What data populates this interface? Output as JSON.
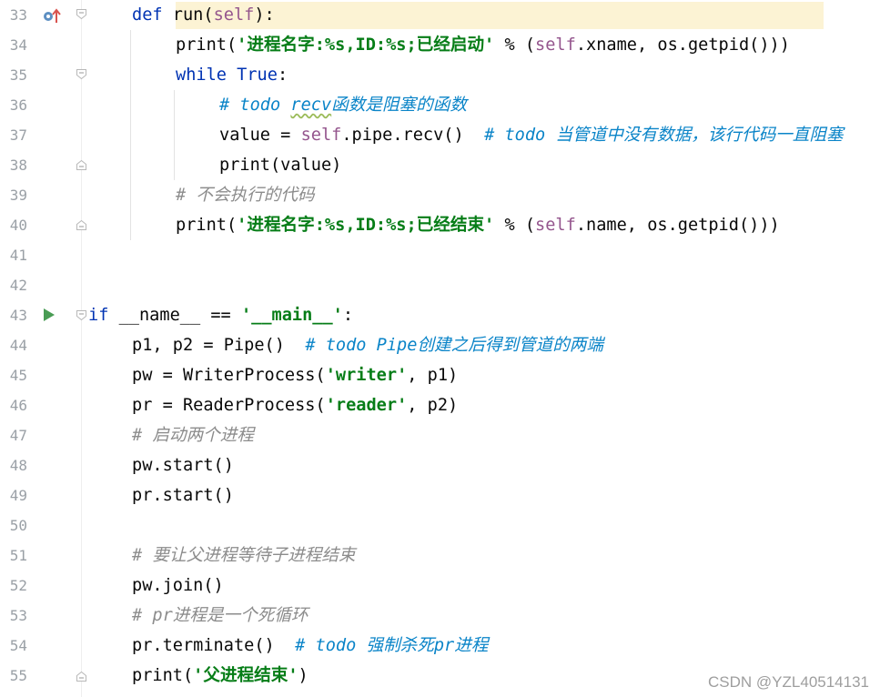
{
  "lines": [
    {
      "num": "33",
      "tokens": [
        {
          "t": "def ",
          "c": "kw"
        },
        {
          "t": "run(",
          "c": ""
        },
        {
          "t": "self",
          "c": "sf"
        },
        {
          "t": "):",
          "c": ""
        }
      ]
    },
    {
      "num": "34",
      "tokens": [
        {
          "t": "print(",
          "c": ""
        },
        {
          "t": "'进程名字:%s,ID:%s;已经启动'",
          "c": "str"
        },
        {
          "t": " % (",
          "c": ""
        },
        {
          "t": "self",
          "c": "sf"
        },
        {
          "t": ".xname, os.getpid()))",
          "c": ""
        }
      ]
    },
    {
      "num": "35",
      "tokens": [
        {
          "t": "while ",
          "c": "kw"
        },
        {
          "t": "True",
          "c": "kw"
        },
        {
          "t": ":",
          "c": ""
        }
      ]
    },
    {
      "num": "36",
      "tokens": [
        {
          "t": "# ",
          "c": "todo"
        },
        {
          "t": "todo ",
          "c": "todo"
        },
        {
          "t": "recv",
          "c": "todo wavy"
        },
        {
          "t": "函数是阻塞的函数",
          "c": "todo"
        }
      ]
    },
    {
      "num": "37",
      "tokens": [
        {
          "t": "value = ",
          "c": ""
        },
        {
          "t": "self",
          "c": "sf"
        },
        {
          "t": ".pipe.recv()  ",
          "c": ""
        },
        {
          "t": "# todo 当管道中没有数据，该行代码一直阻塞",
          "c": "todo"
        }
      ]
    },
    {
      "num": "38",
      "tokens": [
        {
          "t": "print(value)",
          "c": ""
        }
      ]
    },
    {
      "num": "39",
      "tokens": [
        {
          "t": "# 不会执行的代码",
          "c": "cm"
        }
      ]
    },
    {
      "num": "40",
      "tokens": [
        {
          "t": "print(",
          "c": ""
        },
        {
          "t": "'进程名字:%s,ID:%s;已经结束'",
          "c": "str"
        },
        {
          "t": " % (",
          "c": ""
        },
        {
          "t": "self",
          "c": "sf"
        },
        {
          "t": ".name, os.getpid()))",
          "c": ""
        }
      ]
    },
    {
      "num": "41",
      "tokens": []
    },
    {
      "num": "42",
      "tokens": []
    },
    {
      "num": "43",
      "tokens": [
        {
          "t": "if ",
          "c": "kw"
        },
        {
          "t": "__name__ == ",
          "c": ""
        },
        {
          "t": "'__main__'",
          "c": "str"
        },
        {
          "t": ":",
          "c": ""
        }
      ]
    },
    {
      "num": "44",
      "tokens": [
        {
          "t": "p1, p2 = Pipe()  ",
          "c": ""
        },
        {
          "t": "# todo Pipe创建之后得到管道的两端",
          "c": "todo"
        }
      ]
    },
    {
      "num": "45",
      "tokens": [
        {
          "t": "pw = WriterProcess(",
          "c": ""
        },
        {
          "t": "'writer'",
          "c": "str"
        },
        {
          "t": ", p1)",
          "c": ""
        }
      ]
    },
    {
      "num": "46",
      "tokens": [
        {
          "t": "pr = ReaderProcess(",
          "c": ""
        },
        {
          "t": "'reader'",
          "c": "str"
        },
        {
          "t": ", p2)",
          "c": ""
        }
      ]
    },
    {
      "num": "47",
      "tokens": [
        {
          "t": "# 启动两个进程",
          "c": "cm"
        }
      ]
    },
    {
      "num": "48",
      "tokens": [
        {
          "t": "pw.start()",
          "c": ""
        }
      ]
    },
    {
      "num": "49",
      "tokens": [
        {
          "t": "pr.start()",
          "c": ""
        }
      ]
    },
    {
      "num": "50",
      "tokens": []
    },
    {
      "num": "51",
      "tokens": [
        {
          "t": "# 要让父进程等待子进程结束",
          "c": "cm"
        }
      ]
    },
    {
      "num": "52",
      "tokens": [
        {
          "t": "pw.join()",
          "c": ""
        }
      ]
    },
    {
      "num": "53",
      "tokens": [
        {
          "t": "# pr进程是一个死循环",
          "c": "cm"
        }
      ]
    },
    {
      "num": "54",
      "tokens": [
        {
          "t": "pr.terminate()  ",
          "c": ""
        },
        {
          "t": "# todo 强制杀死pr进程",
          "c": "todo"
        }
      ]
    },
    {
      "num": "55",
      "tokens": [
        {
          "t": "print(",
          "c": ""
        },
        {
          "t": "'父进程结束'",
          "c": "str"
        },
        {
          "t": ")",
          "c": ""
        }
      ]
    }
  ],
  "watermark": "CSDN @YZL40514131",
  "colors": {
    "keyword": "#0033b3",
    "self": "#94558d",
    "string": "#067d17",
    "comment": "#8c8c8c",
    "todo": "#0a84c8",
    "highlight": "#fcf3d4"
  }
}
